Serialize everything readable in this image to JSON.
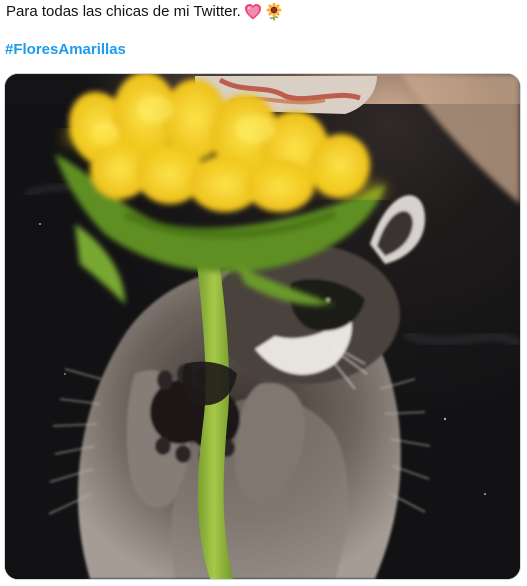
{
  "tweet": {
    "text": "Para todas las chicas de mi Twitter.",
    "emojis": [
      "heart-icon",
      "sunflower-icon"
    ],
    "hashtag": "#FloresAmarillas"
  },
  "media": {
    "subject": "raccoon-holding-sunflower-photo"
  },
  "colors": {
    "hashtag": "#1d9bf0",
    "text": "#0f1419",
    "border": "#cfd9de",
    "petal": "#f7d51c"
  }
}
